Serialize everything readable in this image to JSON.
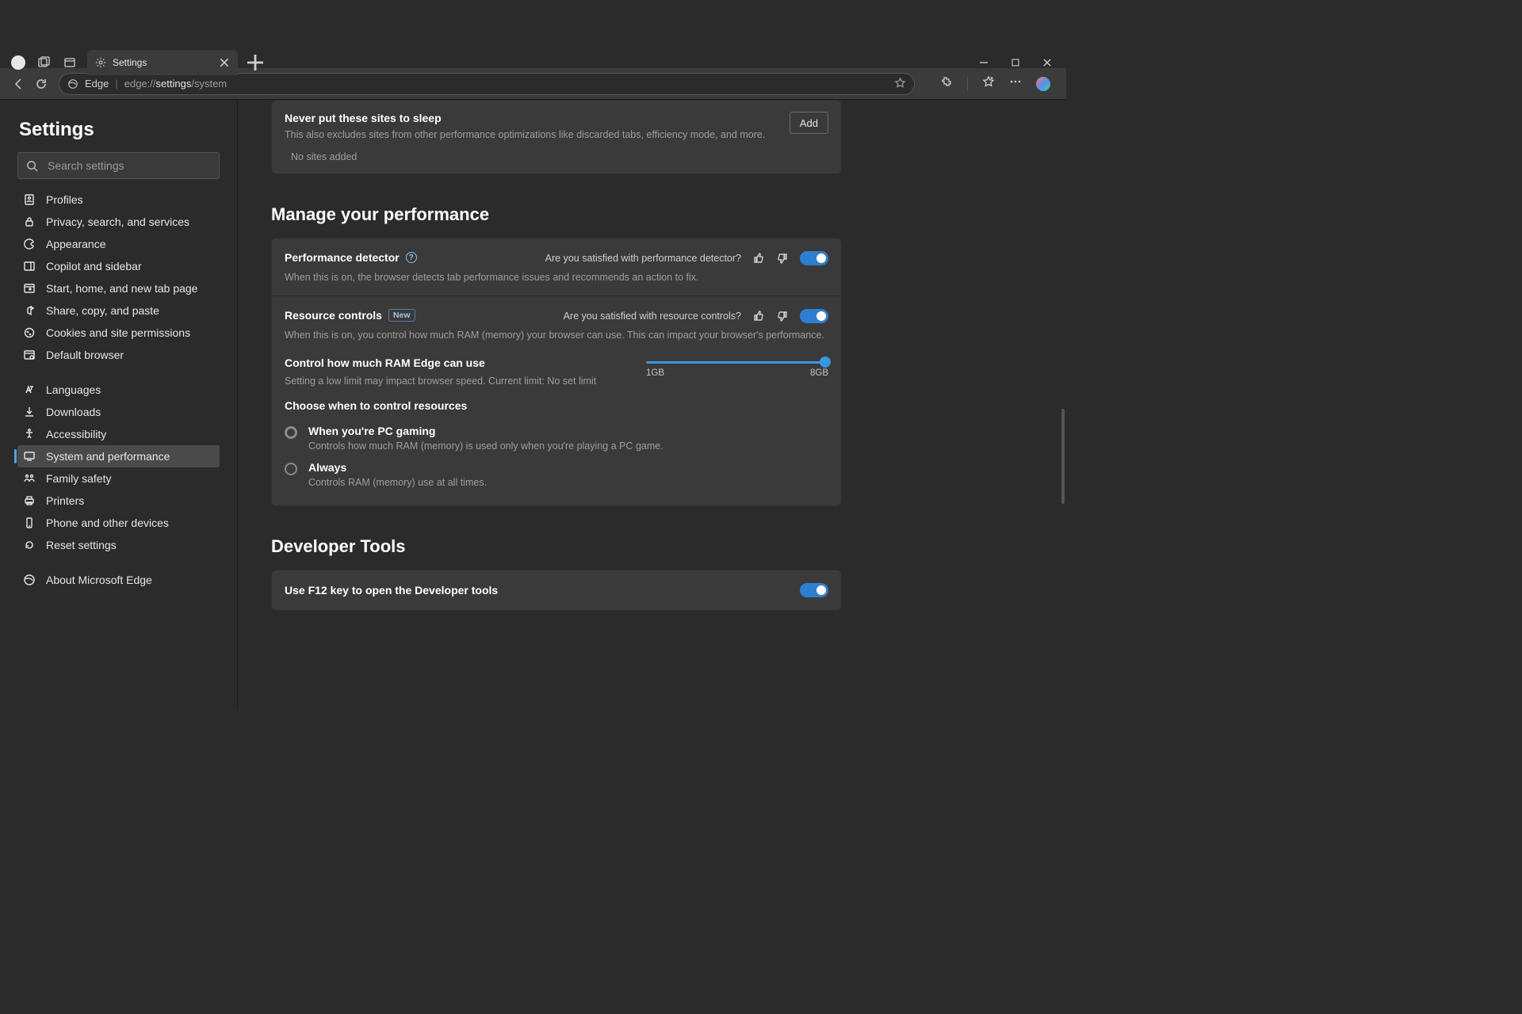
{
  "tab": {
    "title": "Settings"
  },
  "omnibox": {
    "brand": "Edge",
    "url_prefix": "edge://",
    "url_bold": "settings",
    "url_suffix": "/system"
  },
  "sidebar": {
    "title": "Settings",
    "search_placeholder": "Search settings",
    "items": [
      {
        "label": "Profiles"
      },
      {
        "label": "Privacy, search, and services"
      },
      {
        "label": "Appearance"
      },
      {
        "label": "Copilot and sidebar"
      },
      {
        "label": "Start, home, and new tab page"
      },
      {
        "label": "Share, copy, and paste"
      },
      {
        "label": "Cookies and site permissions"
      },
      {
        "label": "Default browser"
      },
      {
        "label": "Languages"
      },
      {
        "label": "Downloads"
      },
      {
        "label": "Accessibility"
      },
      {
        "label": "System and performance"
      },
      {
        "label": "Family safety"
      },
      {
        "label": "Printers"
      },
      {
        "label": "Phone and other devices"
      },
      {
        "label": "Reset settings"
      },
      {
        "label": "About Microsoft Edge"
      }
    ]
  },
  "sleep_card": {
    "title": "Never put these sites to sleep",
    "desc": "This also excludes sites from other performance optimizations like discarded tabs, efficiency mode, and more.",
    "empty": "No sites added",
    "add": "Add"
  },
  "perf_section": {
    "heading": "Manage your performance"
  },
  "perf_detector": {
    "title": "Performance detector",
    "desc": "When this is on, the browser detects tab performance issues and recommends an action to fix.",
    "feedback_q": "Are you satisfied with performance detector?",
    "toggle_on": true
  },
  "resource_controls": {
    "title": "Resource controls",
    "badge": "New",
    "desc": "When this is on, you control how much RAM (memory) your browser can use. This can impact your browser's performance.",
    "feedback_q": "Are you satisfied with resource controls?",
    "toggle_on": true,
    "ram": {
      "title": "Control how much RAM Edge can use",
      "desc": "Setting a low limit may impact browser speed. Current limit: No set limit",
      "min_label": "1GB",
      "max_label": "8GB"
    },
    "choose_heading": "Choose when to control resources",
    "opt_gaming": {
      "label": "When you're PC gaming",
      "desc": "Controls how much RAM (memory) is used only when you're playing a PC game."
    },
    "opt_always": {
      "label": "Always",
      "desc": "Controls RAM (memory) use at all times."
    }
  },
  "dev_section": {
    "heading": "Developer Tools",
    "f12_label": "Use F12 key to open the Developer tools",
    "f12_on": true
  }
}
